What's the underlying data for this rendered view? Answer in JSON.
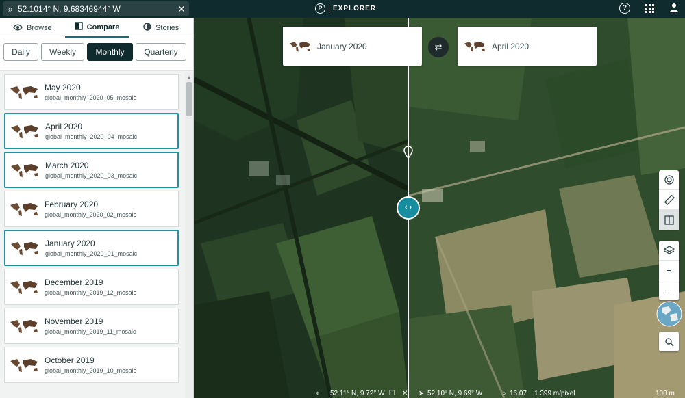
{
  "search": {
    "value": "52.1014° N, 9.68346944° W",
    "icon": "search-icon",
    "clear_icon": "close-icon"
  },
  "brand": {
    "logo_letter": "P",
    "name": "EXPLORER"
  },
  "top_icons": [
    "help-icon",
    "apps-grid-icon",
    "user-icon"
  ],
  "help_glyph": "?",
  "tabs": [
    {
      "label": "Browse",
      "icon": "eye-icon"
    },
    {
      "label": "Compare",
      "icon": "compare-icon"
    },
    {
      "label": "Stories",
      "icon": "stories-icon"
    }
  ],
  "periods": [
    "Daily",
    "Weekly",
    "Monthly",
    "Quarterly"
  ],
  "active_period": "Monthly",
  "mosaics": [
    {
      "title": "May 2020",
      "subtitle": "global_monthly_2020_05_mosaic",
      "selected": false
    },
    {
      "title": "April 2020",
      "subtitle": "global_monthly_2020_04_mosaic",
      "selected": true
    },
    {
      "title": "March 2020",
      "subtitle": "global_monthly_2020_03_mosaic",
      "selected": true
    },
    {
      "title": "February 2020",
      "subtitle": "global_monthly_2020_02_mosaic",
      "selected": false
    },
    {
      "title": "January 2020",
      "subtitle": "global_monthly_2020_01_mosaic",
      "selected": true
    },
    {
      "title": "December 2019",
      "subtitle": "global_monthly_2019_12_mosaic",
      "selected": false
    },
    {
      "title": "November 2019",
      "subtitle": "global_monthly_2019_11_mosaic",
      "selected": false
    },
    {
      "title": "October 2019",
      "subtitle": "global_monthly_2019_10_mosaic",
      "selected": false
    }
  ],
  "compare": {
    "left_label": "January 2020",
    "right_label": "April 2020",
    "swap_icon": "swap-arrows-icon",
    "handle_glyph": "‹ ›"
  },
  "map_tools": {
    "group1": [
      "analysis-icon",
      "ruler-icon",
      "compare-split-icon"
    ],
    "group2": [
      "layers-icon",
      "zoom-in-icon",
      "zoom-out-icon"
    ],
    "zoom_in_glyph": "+",
    "zoom_out_glyph": "−"
  },
  "status": {
    "left_coords": "52.11° N, 9.72° W",
    "right_coords": "52.10° N, 9.69° W",
    "zoom": "16.07",
    "resolution": "1.399 m/pixel",
    "scale": "100 m"
  },
  "colors": {
    "accent": "#1e94a3",
    "header": "#0f2b2d",
    "active_period_bg": "#0f2b2d"
  }
}
